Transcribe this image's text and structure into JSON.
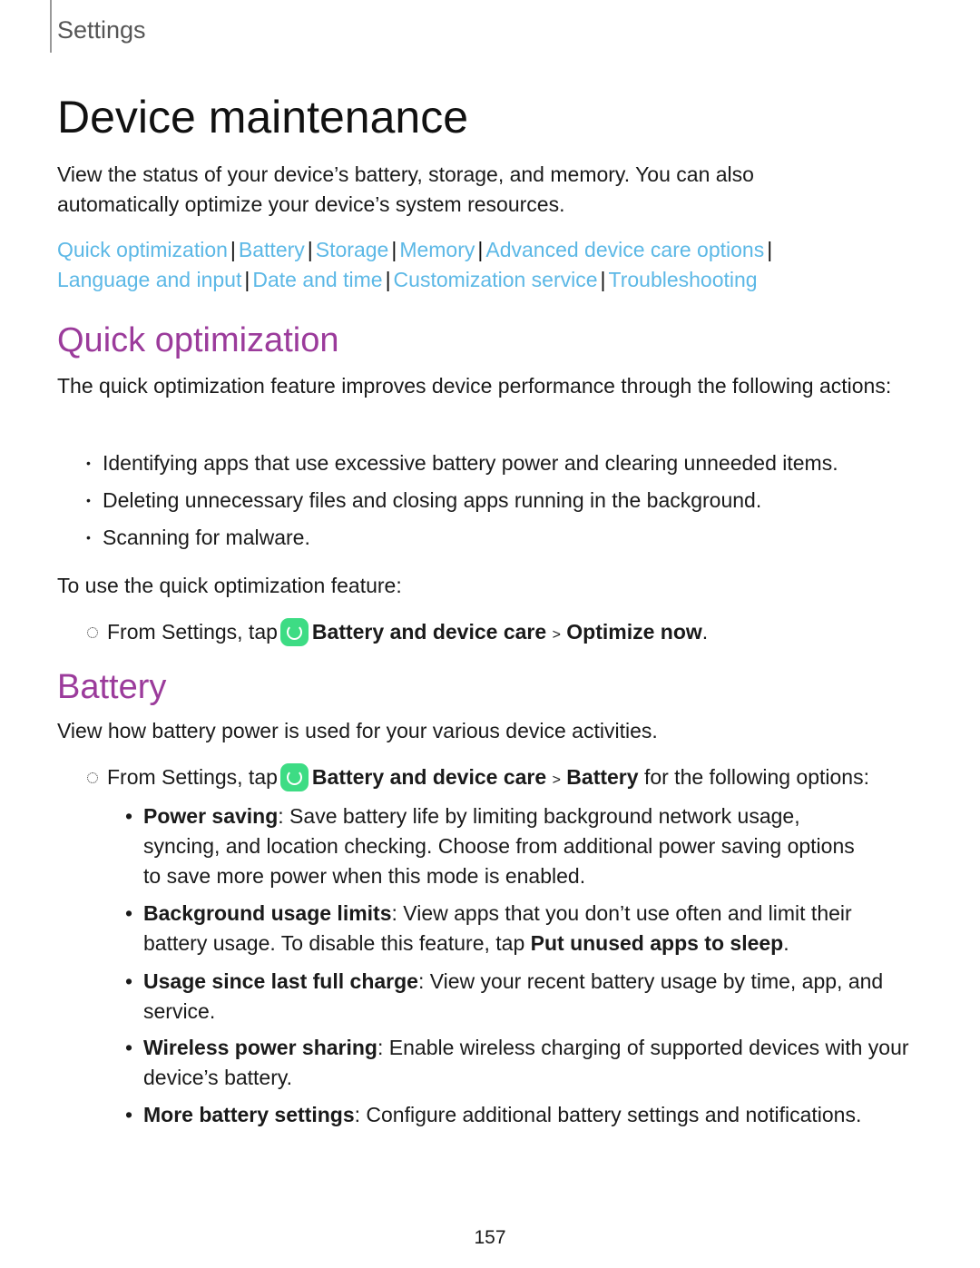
{
  "header": {
    "section": "Settings"
  },
  "title": "Device maintenance",
  "intro": "View the status of your device’s battery, storage, and memory. You can also automatically optimize your device’s system resources.",
  "links": [
    "Quick optimization",
    "Battery",
    "Storage",
    "Memory",
    "Advanced device care options",
    "Language and input",
    "Date and time",
    "Customization service",
    "Troubleshooting"
  ],
  "quick": {
    "heading": "Quick optimization",
    "text": "The quick optimization feature improves device performance through the following actions:",
    "bullets": [
      "Identifying apps that use excessive battery power and clearing unneeded items.",
      "Deleting unnecessary files and closing apps running in the background.",
      "Scanning for malware."
    ],
    "use": "To use the quick optimization feature:",
    "step": {
      "pre": "From Settings, tap",
      "app": "Battery and device care",
      "sep": ">",
      "target": "Optimize now",
      "post": "."
    }
  },
  "battery": {
    "heading": "Battery",
    "text": "View how battery power is used for your various device activities.",
    "step": {
      "pre": "From Settings, tap",
      "app": "Battery and device care",
      "sep": ">",
      "target": "Battery",
      "post": "for the following options:"
    },
    "options": [
      {
        "term": "Power saving",
        "desc": ": Save battery life by limiting background network usage, syncing, and location checking. Choose from additional power saving options to save more power when this mode is enabled."
      },
      {
        "term": "Background usage limits",
        "desc": ": View apps that you don’t use often and limit their battery usage. To disable this feature, tap ",
        "extra": "Put unused apps to sleep",
        "end": "."
      },
      {
        "term": "Usage since last full charge",
        "desc": ": View your recent battery usage by time, app, and service."
      },
      {
        "term": "Wireless power sharing",
        "desc": ": Enable wireless charging of supported devices with your device’s battery."
      },
      {
        "term": "More battery settings",
        "desc": ": Configure additional battery settings and notifications."
      }
    ]
  },
  "colors": {
    "link": "#5cb8e6",
    "heading": "#9b3b9b",
    "app_icon": "#3ddc84"
  },
  "page_number": "157"
}
